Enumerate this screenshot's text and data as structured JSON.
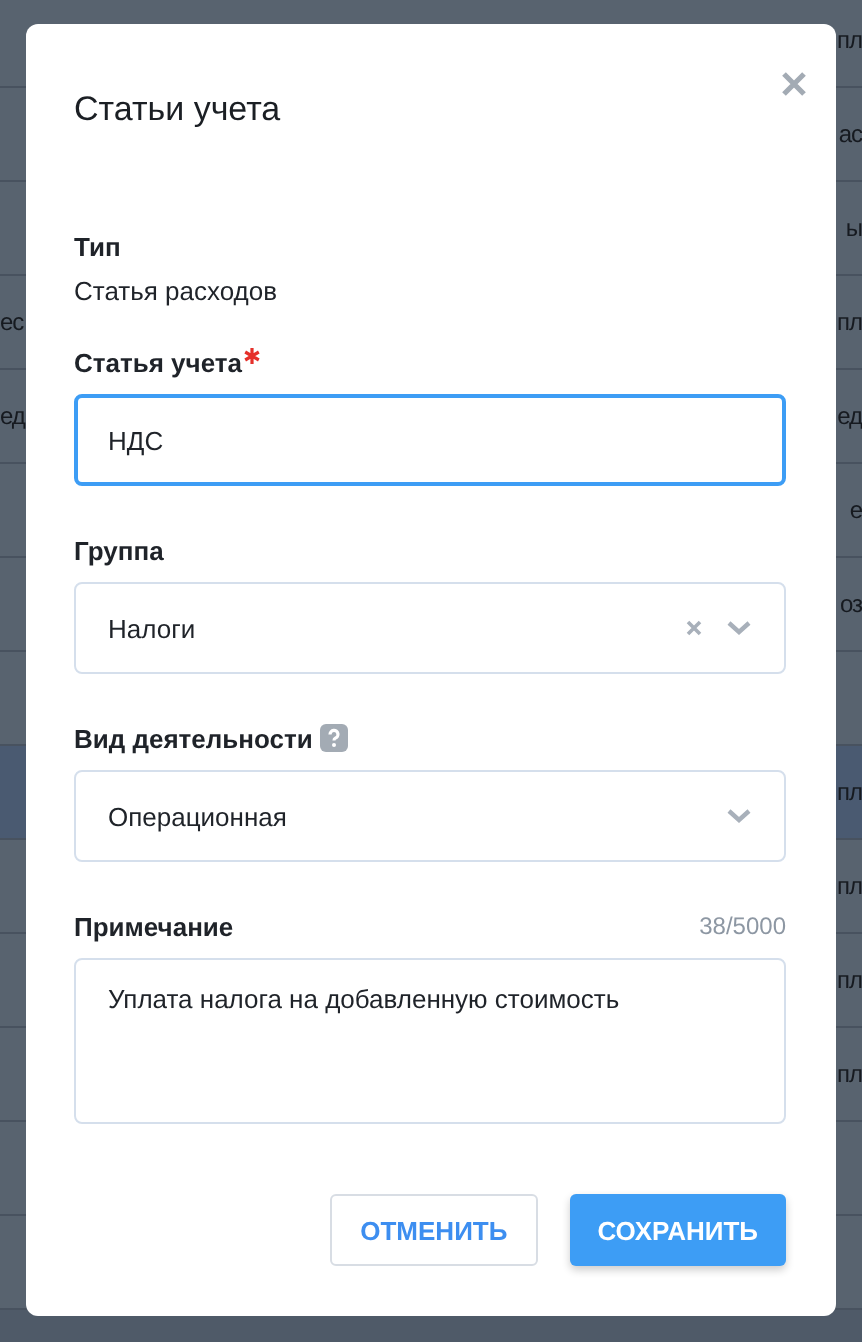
{
  "background_table": {
    "rows": [
      {
        "column_2_fragment": "пл",
        "selected": false
      },
      {
        "column_2_fragment": "ас",
        "selected": false
      },
      {
        "column_2_fragment": "ы",
        "selected": false
      },
      {
        "column_1_fragment": "ес",
        "column_2_fragment": "пл",
        "selected": false
      },
      {
        "column_1_fragment": "ед",
        "column_2_fragment": "ед",
        "selected": false
      },
      {
        "column_2_fragment": "е",
        "selected": false
      },
      {
        "column_2_fragment": "оз",
        "selected": false
      },
      {
        "selected": false
      },
      {
        "column_2_fragment": "пл",
        "selected": true
      },
      {
        "column_2_fragment": "пл",
        "selected": false
      },
      {
        "column_2_fragment": "пл",
        "selected": false
      },
      {
        "column_2_fragment": "пл",
        "selected": false
      },
      {
        "selected": false
      },
      {
        "selected": false
      }
    ]
  },
  "dialog": {
    "title": "Статьи учета",
    "type_label": "Тип",
    "type_value": "Статья расходов",
    "fields": [
      {
        "kind": "text",
        "label": "Статья учета",
        "required": true,
        "value": "НДС",
        "focused": true
      },
      {
        "kind": "select",
        "label": "Группа",
        "value": "Налоги",
        "focused": false,
        "clearable": true
      },
      {
        "kind": "select",
        "label": "Вид деятельности",
        "help": true,
        "value": "Операционная",
        "focused": false
      },
      {
        "kind": "textarea",
        "label": "Примечание",
        "value": "Уплата налога на добавленную стоимость",
        "counter": "38/5000",
        "focused": false
      }
    ],
    "buttons": [
      {
        "kind": "secondary",
        "label": "ОТМЕНИТЬ"
      },
      {
        "kind": "primary",
        "label": "СОХРАНИТЬ"
      }
    ]
  }
}
